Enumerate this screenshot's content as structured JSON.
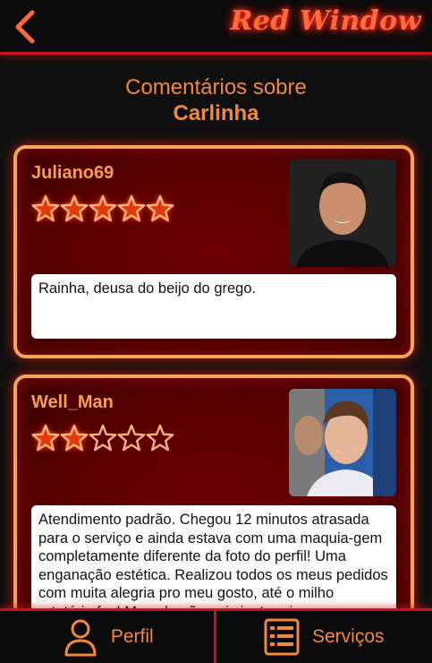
{
  "header": {
    "brand": "Red Window",
    "back_icon": "chevron-left-icon"
  },
  "page": {
    "title_line1": "Comentários sobre",
    "title_line2": "Carlinha"
  },
  "reviews": [
    {
      "reviewer": "Juliano69",
      "rating": 5,
      "rating_max": 5,
      "comment": "Rainha, deusa do beijo do grego."
    },
    {
      "reviewer": "Well_Man",
      "rating": 2,
      "rating_max": 5,
      "comment": "Atendimento padrão. Chegou 12 minutos atrasada para o serviço e ainda estava com uma maquia-gem completamente diferente da foto do perfil! Uma enganação estética. Realizou todos os meus pedidos com muita alegria pro meu gosto, até o milho rotatório fez! Mas ela não quis jantar pipoca"
    }
  ],
  "bottom_nav": {
    "perfil_label": "Perfil",
    "servicos_label": "Serviços",
    "perfil_icon": "user-icon",
    "servicos_icon": "list-icon"
  },
  "colors": {
    "accent_orange": "#f08a3a",
    "neon_red": "#c4161c",
    "card_border": "#f6a35a"
  }
}
